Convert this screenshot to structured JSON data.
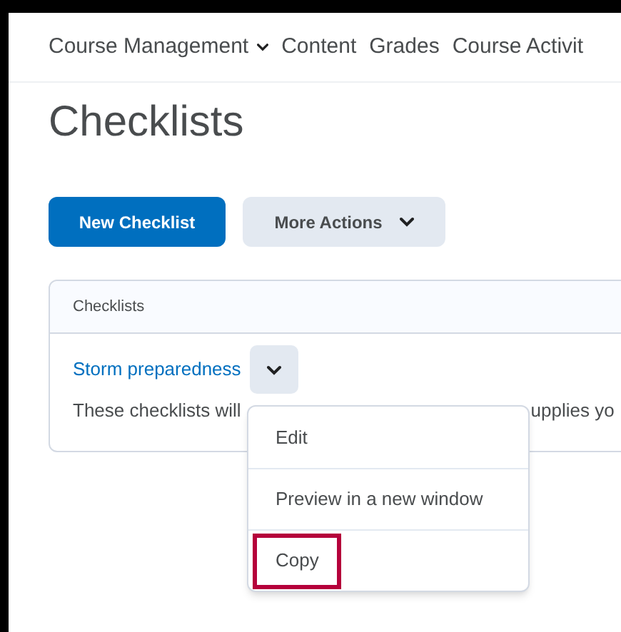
{
  "nav": [
    {
      "label": "Course Management",
      "kind": "dropdown"
    },
    {
      "label": "Content",
      "kind": "link"
    },
    {
      "label": "Grades",
      "kind": "link"
    },
    {
      "label": "Course Activit",
      "kind": "link"
    }
  ],
  "title": "Checklists",
  "buttons": [
    {
      "label": "New Checklist",
      "kind": "primary"
    },
    {
      "label": "More Actions",
      "kind": "dropdown"
    }
  ],
  "table": {
    "header": "Checklists",
    "rows": [
      {
        "name": "Storm preparedness",
        "description_start": "These checklists will",
        "description_end": "upplies yo"
      }
    ]
  },
  "context_menu": {
    "items": [
      {
        "label": "Edit",
        "highlighted": false
      },
      {
        "label": "Preview in a new window",
        "highlighted": false
      },
      {
        "label": "Copy",
        "highlighted": true
      }
    ]
  }
}
